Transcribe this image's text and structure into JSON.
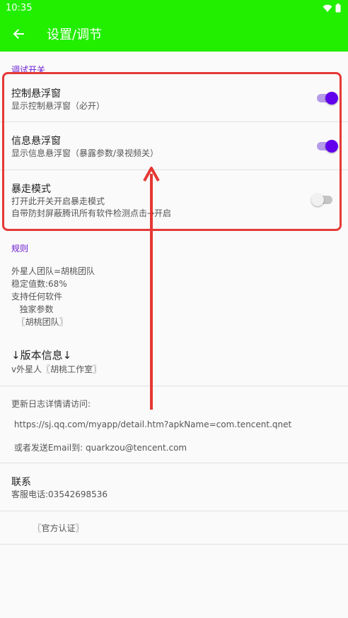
{
  "status_bar": {
    "time": "10:35"
  },
  "app_bar": {
    "title": "设置/调节"
  },
  "debug_section": {
    "header": "调试开关",
    "items": [
      {
        "title": "控制悬浮窗",
        "summary": "显示控制悬浮窗（必开）",
        "checked": true
      },
      {
        "title": "信息悬浮窗",
        "summary": "显示信息悬浮窗（暴露参数/录视频关）",
        "checked": true
      },
      {
        "title": "暴走模式",
        "summary_lines": [
          "打开此开关开启暴走模式",
          "自带防封屏蔽腾讯所有软件检测点击→开启"
        ],
        "checked": false
      }
    ]
  },
  "rules_section": {
    "header": "规则",
    "lines": [
      "外星人团队=胡桃团队",
      "稳定值数:68%",
      "支持任何软件",
      "   独家参数",
      "  〖胡桃团队〗"
    ]
  },
  "version": {
    "title": "↓版本信息↓",
    "summary": "v外星人〖胡桃工作室〗"
  },
  "changelog": {
    "label": "更新日志详情请访问:",
    "url": " https://sj.qq.com/myapp/detail.htm?apkName=com.tencent.qnet",
    "email": " 或者发送Email到: quarkzou@tencent.com"
  },
  "contact": {
    "title": "联系",
    "summary": "客服电话:03542698536"
  },
  "official": {
    "label": "        〖官方认证〗"
  },
  "colors": {
    "app_bar": "#22ee00",
    "accent": "#6200ee",
    "section_header": "#6a1bd1",
    "annotation": "#e53935"
  },
  "icons": {
    "back": "arrow-left-icon",
    "wifi": "wifi-icon",
    "battery": "battery-icon"
  }
}
